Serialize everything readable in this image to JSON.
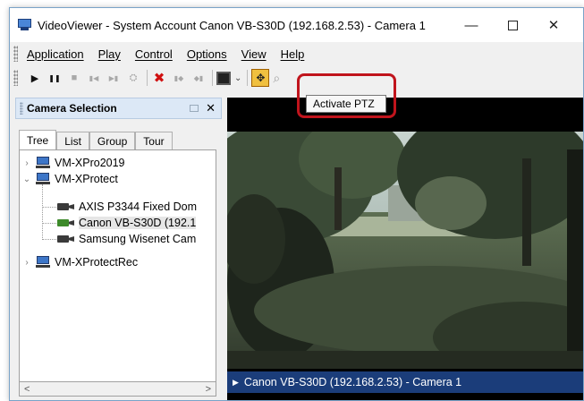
{
  "window": {
    "title": "VideoViewer - System Account Canon VB-S30D (192.168.2.53) - Camera 1",
    "minimize_glyph": "—",
    "close_glyph": "✕"
  },
  "menu": {
    "items": [
      "Application",
      "Play",
      "Control",
      "Options",
      "View",
      "Help"
    ]
  },
  "toolbar": {
    "buttons": [
      "play",
      "pause",
      "stop",
      "step-back",
      "step-forward",
      "find",
      "delete",
      "prev-camera",
      "next-camera",
      "fullscreen",
      "activate-ptz",
      "zoom"
    ],
    "play_glyph": "▶",
    "pause_glyph": "❚❚",
    "stop_glyph": "■",
    "step_back_glyph": "▮◀",
    "step_forward_glyph": "▶▮",
    "find_glyph": "⛭",
    "delete_glyph": "✖",
    "prev_glyph": "▮◆",
    "next_glyph": "◆▮",
    "caret_glyph": "⌄",
    "ptz_glyph": "✥",
    "zoom_glyph": "⌕",
    "tooltip": "Activate PTZ",
    "highlight_color": "#c0141c"
  },
  "camera_panel": {
    "title": "Camera Selection",
    "close_glyph": "✕",
    "tabs": [
      "Tree",
      "List",
      "Group",
      "Tour"
    ],
    "active_tab": "Tree",
    "tree": {
      "servers": [
        {
          "label": "VM-XPro2019",
          "expanded": false,
          "chevron": "›"
        },
        {
          "label": "VM-XProtect",
          "expanded": true,
          "chevron": "⌄"
        },
        {
          "label": "VM-XProtectRec",
          "expanded": false,
          "chevron": "›"
        }
      ],
      "cameras": [
        {
          "label": "AXIS P3344 Fixed Dom",
          "live": false
        },
        {
          "label": "Canon VB-S30D (192.1",
          "live": true,
          "selected": true
        },
        {
          "label": "Samsung Wisenet Cam",
          "live": false
        }
      ]
    },
    "scroll_left": "<",
    "scroll_right": ">"
  },
  "video": {
    "status_text": "Canon VB-S30D (192.168.2.53) - Camera 1",
    "status_glyph": "▶",
    "status_bar_color": "#1b3d7a"
  }
}
